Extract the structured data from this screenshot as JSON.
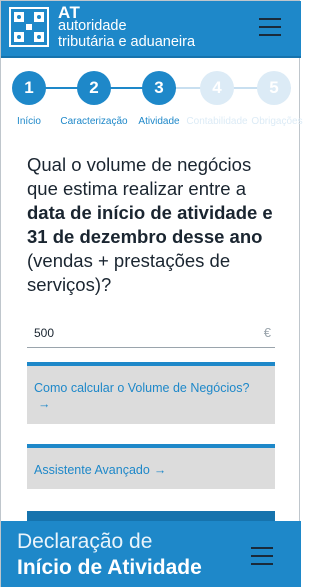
{
  "header": {
    "brand_at": "AT",
    "brand_line1": "autoridade",
    "brand_line2": "tributária e aduaneira",
    "logo_icon": "portugal-coat-of-arms-icon",
    "menu_icon": "hamburger-menu-icon"
  },
  "stepper": {
    "steps": [
      {
        "number": "1",
        "label": "Início",
        "active": true
      },
      {
        "number": "2",
        "label": "Caracterização",
        "active": true
      },
      {
        "number": "3",
        "label": "Atividade",
        "active": true
      },
      {
        "number": "4",
        "label": "Contabilidade",
        "active": false
      },
      {
        "number": "5",
        "label": "Obrigações",
        "active": false
      }
    ]
  },
  "question": {
    "part1": "Qual o volume de negócios que estima realizar entre a ",
    "part2": "data de início de atividade e 31 de dezembro desse ano",
    "part3": " (vendas + prestações de serviços)?"
  },
  "input": {
    "value": "500",
    "currency": "€"
  },
  "help_links": {
    "calc_label": "Como calcular o Volume de Negócios?",
    "assistant_label": "Assistente Avançado",
    "arrow": "→"
  },
  "footer": {
    "line1": "Declaração de",
    "line2": "Início de Atividade"
  },
  "colors": {
    "primary": "#1e88c9",
    "inactive_step": "#dcebf6",
    "box_bg": "#dcdcdc"
  }
}
